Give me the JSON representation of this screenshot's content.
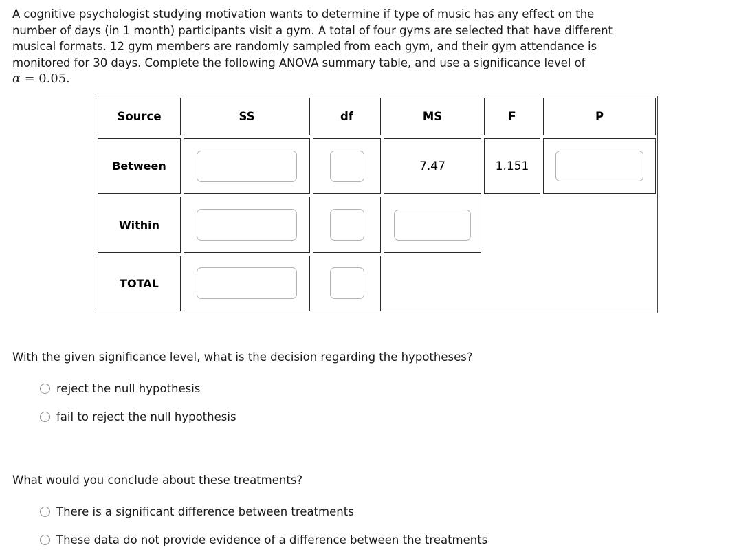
{
  "prompt": {
    "line1": "A cognitive psychologist studying motivation wants to determine if type of music has any effect on the",
    "line2": "number of days (in 1 month) participants visit a gym.  A total of four gyms are selected that have different",
    "line3": "musical formats.  12 gym members are randomly sampled from each gym, and their gym attendance is",
    "line4": "monitored for 30 days.  Complete the following ANOVA summary table, and use a significance level of",
    "alpha_symbol": "α",
    "alpha_rest": " = 0.05."
  },
  "anova_table": {
    "headers": [
      "Source",
      "SS",
      "df",
      "MS",
      "F",
      "P"
    ],
    "rows": [
      {
        "source": "Between",
        "ss": "",
        "df": "",
        "ms": "7.47",
        "f": "1.151",
        "p": ""
      },
      {
        "source": "Within",
        "ss": "",
        "df": "",
        "ms": "",
        "f": null,
        "p": null
      },
      {
        "source": "TOTAL",
        "ss": "",
        "df": "",
        "ms": null,
        "f": null,
        "p": null
      }
    ]
  },
  "question1": {
    "text": "With the given significance level, what is the decision regarding the hypotheses?",
    "options": [
      "reject the null hypothesis",
      "fail to reject the null hypothesis"
    ]
  },
  "question2": {
    "text": "What would you conclude about these treatments?",
    "options": [
      "There is a significant difference between treatments",
      "These data do not provide evidence of a difference between the treatments"
    ]
  },
  "colors": {
    "text": "#1a1a1a",
    "table_border": "#2b2b2b",
    "outer_border": "#4a4a4a",
    "input_border": "#b3b3b3",
    "radio_border": "#8c8c8c",
    "background": "#ffffff"
  }
}
